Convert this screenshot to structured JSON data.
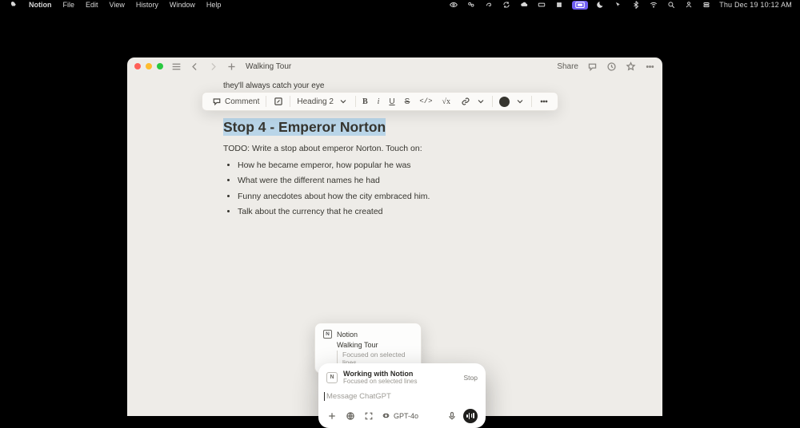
{
  "menubar": {
    "app": "Notion",
    "items": [
      "File",
      "Edit",
      "View",
      "History",
      "Window",
      "Help"
    ],
    "datetime": "Thu Dec 19  10:12 AM"
  },
  "window": {
    "breadcrumb": "Walking Tour",
    "share": "Share"
  },
  "floating_toolbar": {
    "comment": "Comment",
    "block_type": "Heading 2"
  },
  "document": {
    "preline": "they'll always catch your eye",
    "heading": "Stop 4 - Emperor Norton",
    "todo": "TODO: Write a stop about emperor Norton. Touch on:",
    "bullets": [
      "How he became emperor, how popular he was",
      "What were the different names he had",
      "Funny anecdotes about how the city embraced him.",
      "Talk about the currency that he created"
    ]
  },
  "context_card": {
    "app": "Notion",
    "page": "Walking Tour",
    "hint": "Focused on selected lines"
  },
  "gpt_panel": {
    "title": "Working with Notion",
    "subtitle": "Focused on selected lines",
    "stop": "Stop",
    "placeholder": "Message ChatGPT",
    "model": "GPT-4o"
  }
}
